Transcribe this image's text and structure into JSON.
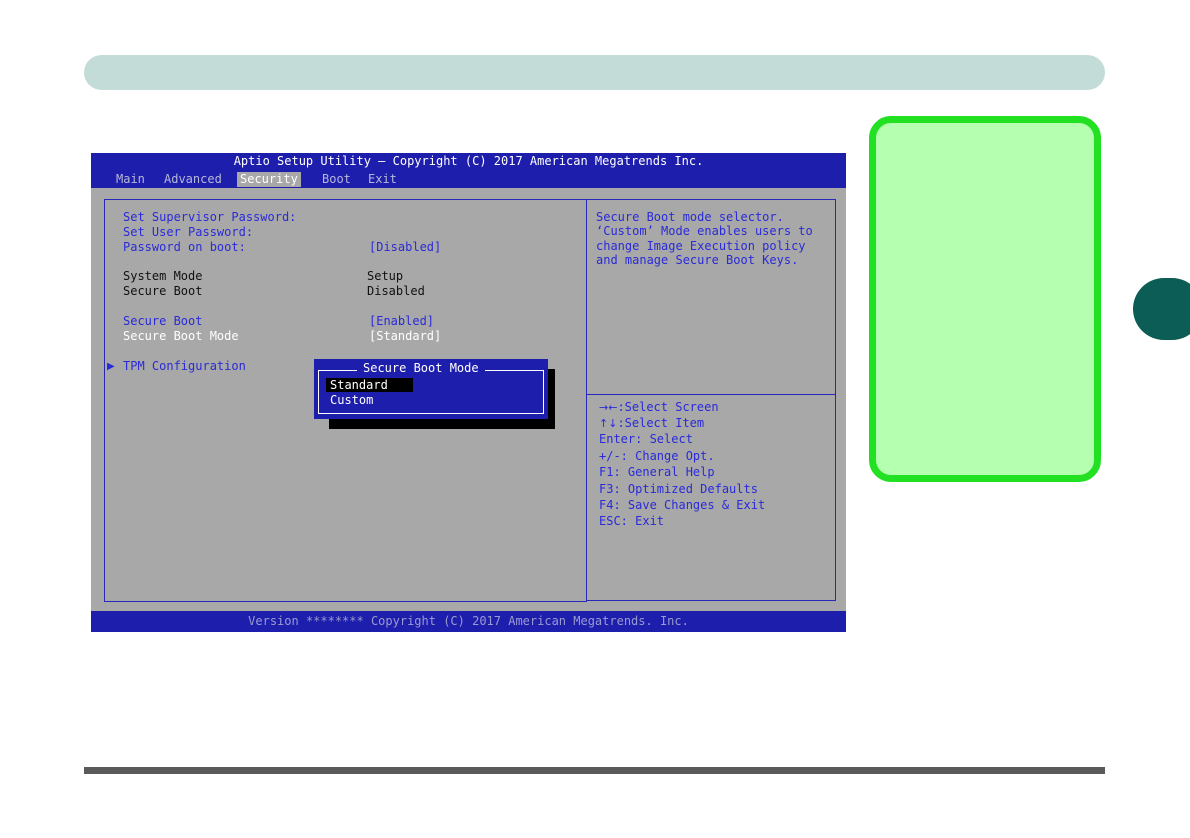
{
  "bios": {
    "title": "Aptio Setup Utility – Copyright (C) 2017 American Megatrends Inc.",
    "tabs": [
      "Main",
      "Advanced",
      "Security",
      "Boot",
      "Exit"
    ],
    "active_tab": "Security",
    "settings": {
      "supervisor_password": "Set Supervisor Password:",
      "user_password": "Set User Password:",
      "password_on_boot": {
        "label": "Password on boot:",
        "value": "[Disabled]"
      },
      "system_mode": {
        "label": "System Mode",
        "value": "Setup"
      },
      "secure_boot_status": {
        "label": "Secure Boot",
        "value": "Disabled"
      },
      "secure_boot": {
        "label": "Secure Boot",
        "value": "[Enabled]"
      },
      "secure_boot_mode": {
        "label": "Secure Boot Mode",
        "value": "[Standard]"
      },
      "tpm_configuration": "TPM Configuration"
    },
    "help_text": [
      "Secure Boot mode selector.",
      "‘Custom’ Mode enables users to",
      "change Image Execution policy",
      "and manage Secure Boot Keys."
    ],
    "keys": {
      "select_screen": ":Select Screen",
      "select_item": ":Select Item",
      "enter": "Enter: Select",
      "change": "+/-: Change Opt.",
      "f1": "F1: General Help",
      "f3": "F3: Optimized Defaults",
      "f4": "F4: Save Changes & Exit",
      "esc": "ESC: Exit"
    },
    "popup": {
      "title": "Secure Boot Mode",
      "options": [
        "Standard",
        "Custom"
      ],
      "selected": "Standard"
    },
    "version": "Version ******** Copyright (C) 2017 American Megatrends. Inc."
  },
  "colors": {
    "bios_blue": "#1e1ead",
    "bios_gray": "#a8a8a8",
    "header_bar": "#c4dcd7",
    "chapter_tab": "#0c5d55",
    "note_border": "#22e022",
    "note_fill": "#b4ffb0"
  }
}
